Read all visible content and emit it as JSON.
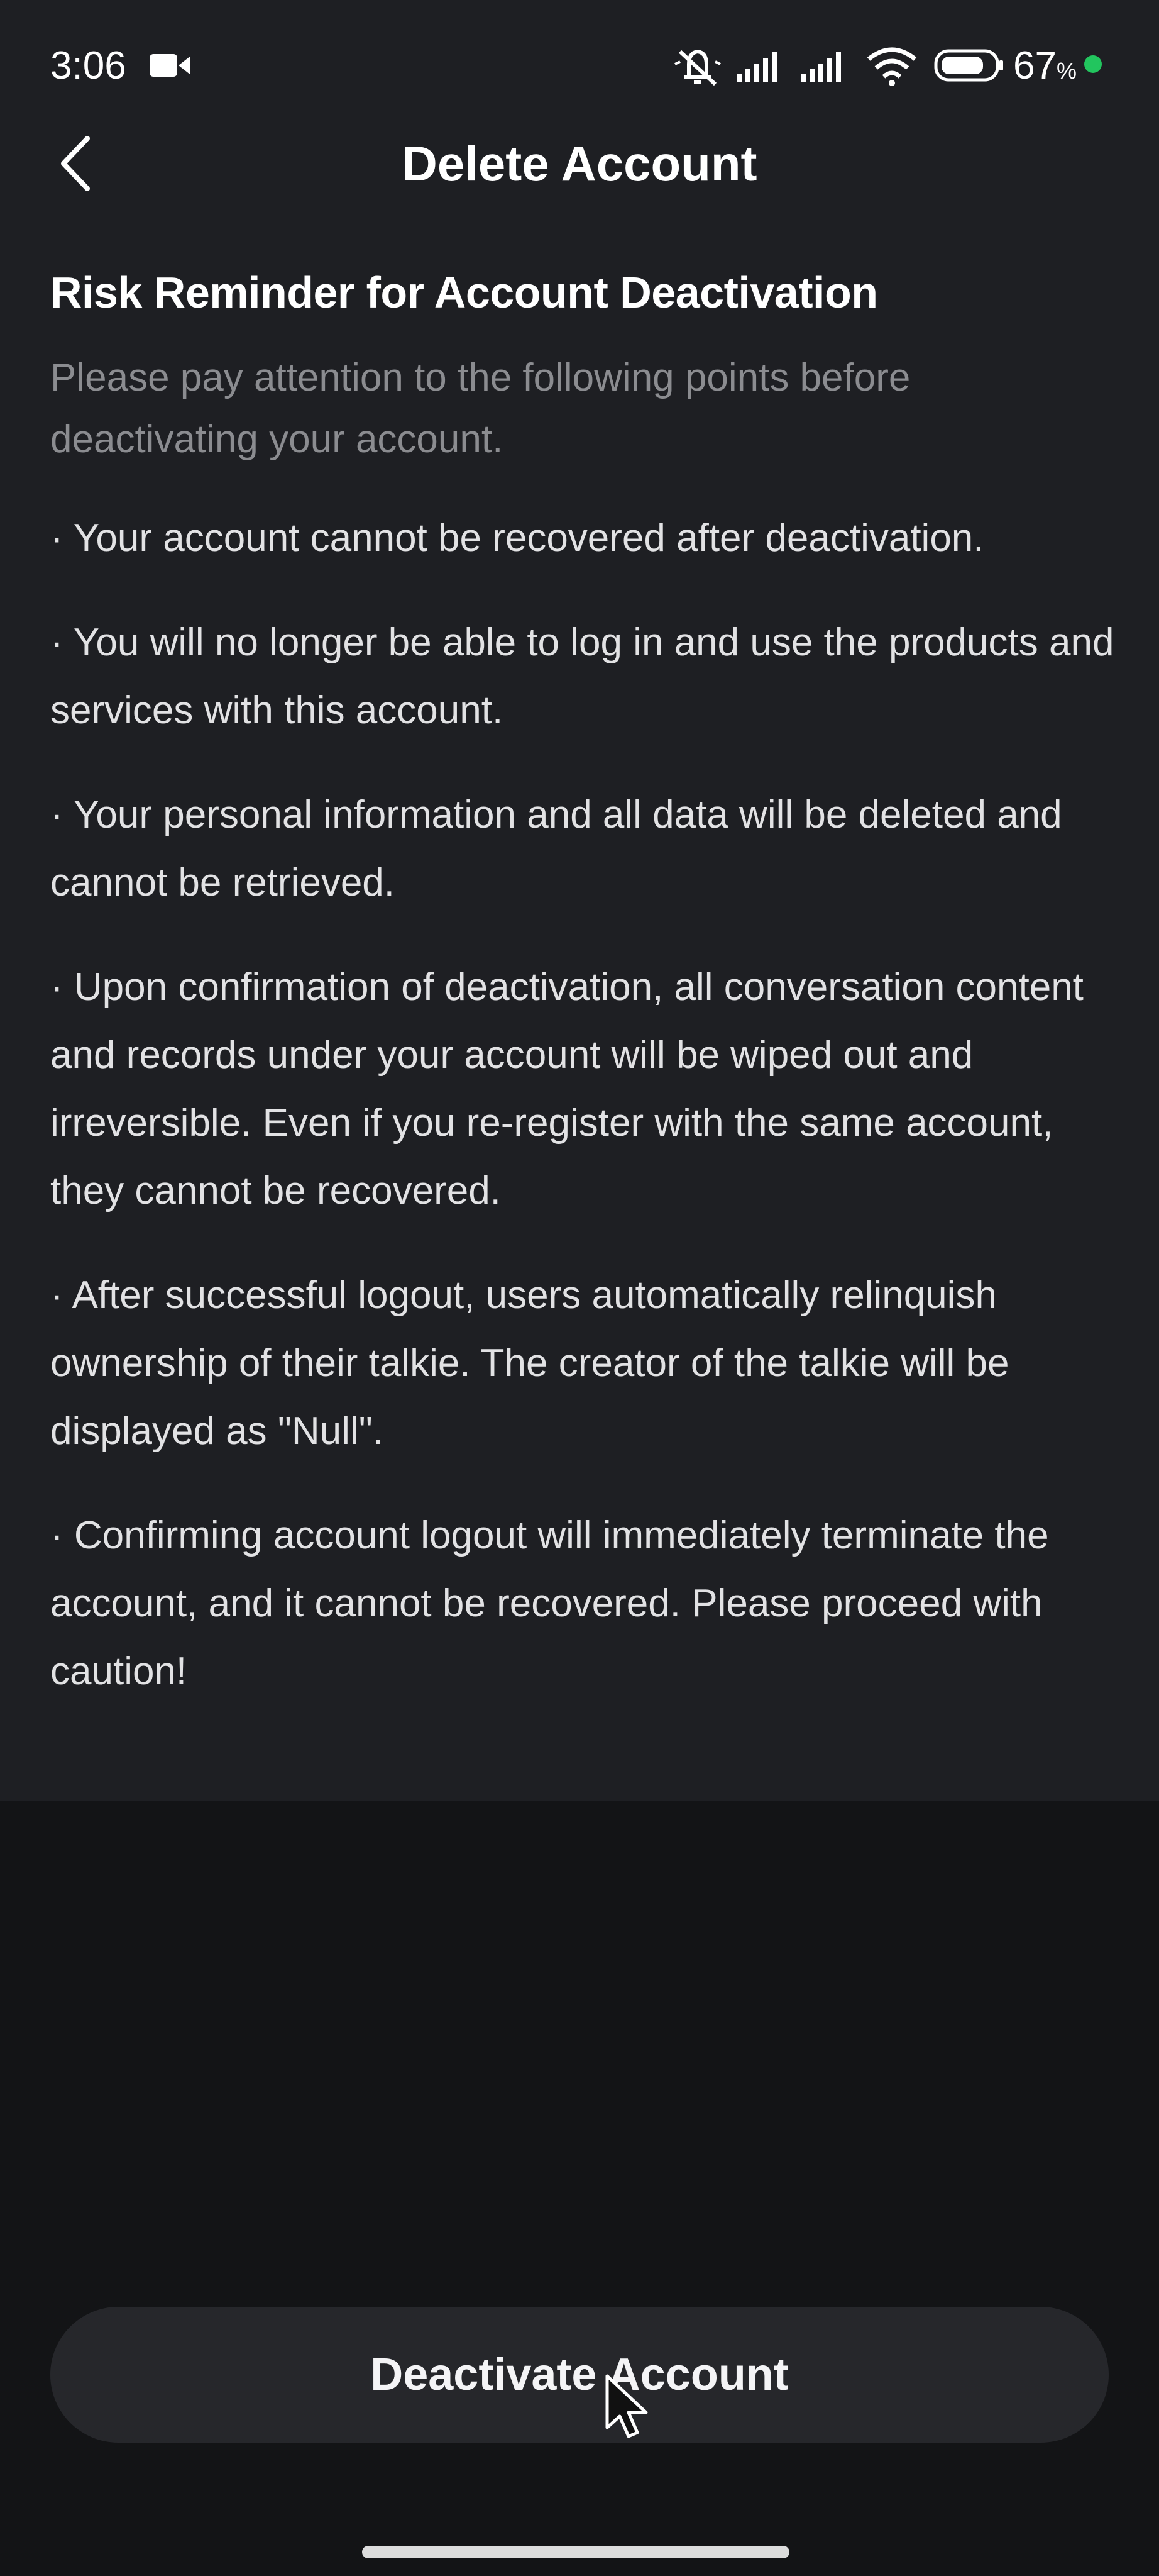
{
  "status_bar": {
    "time": "3:06",
    "battery_percent": "67",
    "battery_unit": "%",
    "icons": [
      "video-camera-icon",
      "muted-bell-icon",
      "signal-icon",
      "signal-icon",
      "wifi-icon",
      "battery-icon",
      "charging-dot-icon"
    ],
    "charge_color": "#22c55e"
  },
  "header": {
    "title": "Delete Account",
    "back_icon": "chevron-left-icon"
  },
  "content": {
    "heading": "Risk Reminder for Account Deactivation",
    "intro": "Please pay attention to the following points before deactivating your account.",
    "points": [
      "· Your account cannot be recovered after deactivation.",
      "· You will no longer be able to log in and use the products and services with this account.",
      "· Your personal information and all data will be deleted and cannot be retrieved.",
      "· Upon confirmation of deactivation, all conversation content and records under your account will be wiped out and irreversible. Even if you re-register with the same account, they cannot be recovered.",
      "· After successful logout, users automatically relinquish ownership of their talkie. The creator of the talkie will be displayed as \"Null\".",
      "· Confirming account logout will immediately terminate the account, and it cannot be recovered. Please proceed with caution!"
    ]
  },
  "actions": {
    "deactivate_label": "Deactivate Account"
  },
  "colors": {
    "panel_background": "#1e1f23",
    "page_background": "#131416",
    "button_background": "#26272b",
    "muted_text": "#8b8c90"
  }
}
